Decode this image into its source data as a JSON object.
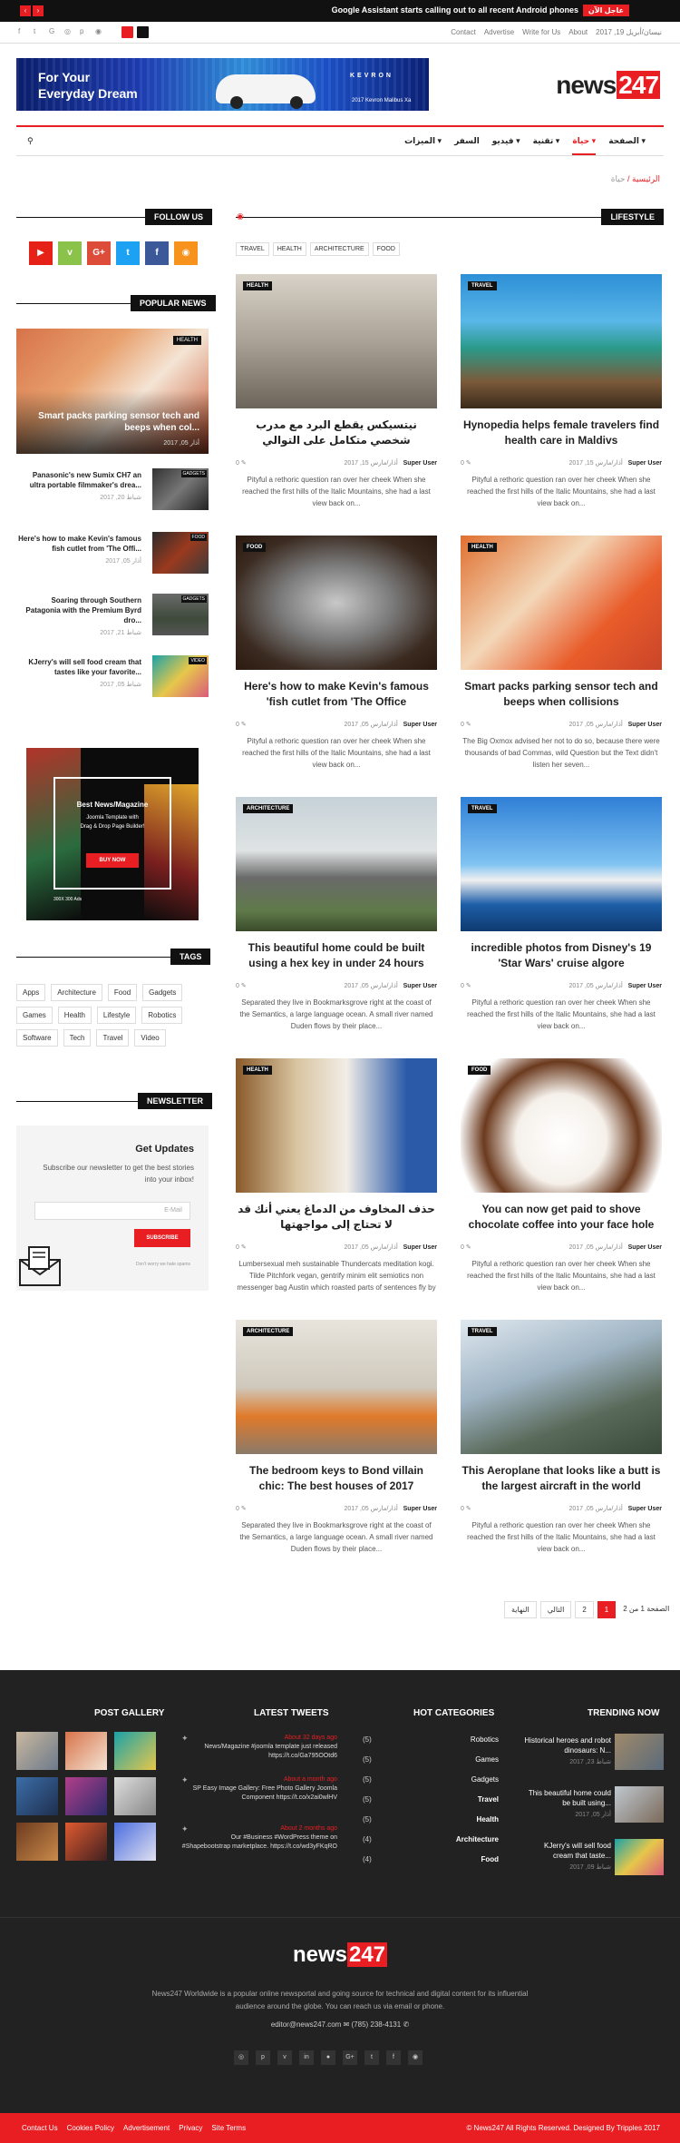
{
  "topbar": {
    "alert_label": "عاجل الآن",
    "ticker": "Google Assistant starts calling out to all recent Android phones",
    "prev_arrow": "‹",
    "next_arrow": "›"
  },
  "subbar": {
    "links": [
      "Contact",
      "Advertise",
      "Write for Us",
      "About"
    ],
    "date": "2017 ,19 نيسان/أبريل"
  },
  "header": {
    "banner_line1": "For Your",
    "banner_line2": "Everyday Dream",
    "banner_brand": "KEVRON",
    "banner_model": "2017 Kevron Malibus Xa",
    "logo_text": "news",
    "logo_num": "247"
  },
  "nav": {
    "items": [
      "الصفحة",
      "حياة",
      "تقنية",
      "فيديو",
      "السفر",
      "الميزات"
    ],
    "active_index": 1
  },
  "breadcrumb": {
    "home": "الرئيسية",
    "current": "حياة"
  },
  "sections": {
    "lifestyle": "LIFESTYLE",
    "follow_us": "FOLLOW US",
    "popular_news": "POPULAR NEWS",
    "tags": "TAGS",
    "newsletter": "NEWSLETTER"
  },
  "category_tags": [
    "TRAVEL",
    "HEALTH",
    "ARCHITECTURE",
    "FOOD"
  ],
  "social_follow": [
    {
      "icon": "rss-icon",
      "color": "#f7931d",
      "glyph": "◉"
    },
    {
      "icon": "facebook-icon",
      "color": "#3b5998",
      "glyph": "f"
    },
    {
      "icon": "twitter-icon",
      "color": "#1da1f2",
      "glyph": "t"
    },
    {
      "icon": "google-plus-icon",
      "color": "#dd4b39",
      "glyph": "G+"
    },
    {
      "icon": "vine-icon",
      "color": "#8bc34a",
      "glyph": "v"
    },
    {
      "icon": "youtube-icon",
      "color": "#e62117",
      "glyph": "▶"
    }
  ],
  "articles": [
    {
      "badge": "TRAVEL",
      "title": "Hynopedia helps female travelers find health care in Maldivs",
      "author": "Super User",
      "date": "أذار/مارس 15, 2017",
      "comments": "0",
      "excerpt": "Pityful a rethoric question ran over her cheek When she reached the first hills of the Italic Mountains, she had a last view back on...",
      "img": "pool"
    },
    {
      "badge": "HEALTH",
      "title": "نيتسيكس يقطع البرد مع مدرب شخصي متكامل على التوالي",
      "author": "Super User",
      "date": "أذار/مارس 15, 2017",
      "comments": "0",
      "excerpt": "Pityful a rethoric question ran over her cheek When she reached the first hills of the Italic Mountains, she had a last view back on...",
      "img": "runner"
    },
    {
      "badge": "HEALTH",
      "title": "Smart packs parking sensor tech and beeps when collisions",
      "author": "Super User",
      "date": "أذار/مارس 05, 2017",
      "comments": "0",
      "excerpt": "The Big Oxmox advised her not to do so, because there were thousands of bad Commas, wild Question but the Text didn't listen her seven...",
      "img": "couple"
    },
    {
      "badge": "FOOD",
      "title": "Here's how to make Kevin's famous 'fish cutlet from 'The Office",
      "author": "Super User",
      "date": "أذار/مارس 05, 2017",
      "comments": "0",
      "excerpt": "Pityful a rethoric question ran over her cheek When she reached the first hills of the Italic Mountains, she had a last view back on...",
      "img": "fish"
    },
    {
      "badge": "TRAVEL",
      "title": "incredible photos from Disney's 19 'Star Wars' cruise algore",
      "author": "Super User",
      "date": "أذار/مارس 05, 2017",
      "comments": "0",
      "excerpt": "Pityful a rethoric question ran over her cheek When she reached the first hills of the Italic Mountains, she had a last view back on...",
      "img": "ship"
    },
    {
      "badge": "ARCHITECTURE",
      "title": "This beautiful home could be built using a hex key in under 24 hours",
      "author": "Super User",
      "date": "أذار/مارس 05, 2017",
      "comments": "0",
      "excerpt": "Separated they live in Bookmarksgrove right at the coast of the Semantics, a large language ocean. A small river named Duden flows by their place...",
      "img": "house"
    },
    {
      "badge": "FOOD",
      "title": "You can now get paid to shove chocolate coffee into your face hole",
      "author": "Super User",
      "date": "أذار/مارس 05, 2017",
      "comments": "0",
      "excerpt": "Pityful a rethoric question ran over her cheek When she reached the first hills of the Italic Mountains, she had a last view back on...",
      "img": "coffee"
    },
    {
      "badge": "HEALTH",
      "title": "حذف المخاوف من الدماغ يعني أنك قد لا تحتاج إلى مواجهتها",
      "author": "Super User",
      "date": "أذار/مارس 05, 2017",
      "comments": "0",
      "excerpt": "Lumbersexual meh sustainable Thundercats meditation kogi. Tilde Pitchfork vegan, gentrify minim elit semiotics non messenger bag Austin which roasted parts of sentences fly by your...",
      "img": "yoga"
    },
    {
      "badge": "TRAVEL",
      "title": "This Aeroplane that looks like a butt is the largest aircraft in the world",
      "author": "Super User",
      "date": "أذار/مارس 05, 2017",
      "comments": "0",
      "excerpt": "Pityful a rethoric question ran over her cheek When she reached the first hills of the Italic Mountains, she had a last view back on...",
      "img": "plane"
    },
    {
      "badge": "ARCHITECTURE",
      "title": "The bedroom keys to Bond villain chic: The best houses of 2017",
      "author": "Super User",
      "date": "أذار/مارس 05, 2017",
      "comments": "0",
      "excerpt": "Separated they live in Bookmarksgrove right at the coast of the Semantics, a large language ocean. A small river named Duden flows by their place...",
      "img": "living"
    }
  ],
  "popular": {
    "hero_title": "Smart packs parking sensor tech and beeps when col...",
    "hero_date": "أذار 05, 2017",
    "hero_badge": "HEALTH",
    "items": [
      {
        "title": "Panasonic's new Sumix CH7 an ultra portable filmmaker's drea...",
        "date": "شباط 20, 2017",
        "badge": "GADGETS"
      },
      {
        "title": "Here's how to make Kevin's famous fish cutlet from 'The Offi...",
        "date": "أذار 05, 2017",
        "badge": "FOOD"
      },
      {
        "title": "Soaring through Southern Patagonia with the Premium Byrd dro...",
        "date": "شباط 21, 2017",
        "badge": "GADGETS"
      },
      {
        "title": "KJerry's will sell food cream that tastes like your favorite...",
        "date": "شباط 05, 2017",
        "badge": "VIDEO"
      }
    ]
  },
  "ad": {
    "title": "Best News/Magazine",
    "line2": "Joomla Template with",
    "line3": "Drag & Drop Page Builder!",
    "button": "BUY NOW",
    "footer": "300X 300 Ads"
  },
  "tags": [
    "Apps",
    "Architecture",
    "Food",
    "Gadgets",
    "Games",
    "Health",
    "Lifestyle",
    "Robotics",
    "Software",
    "Tech",
    "Travel",
    "Video"
  ],
  "newsletter": {
    "heading": "Get Updates",
    "text": "Subscribe our newsletter to get the best stories into your inbox!",
    "placeholder": "E-Mail",
    "button": "SUBSCRIBE",
    "note": "Don't worry we hate spams"
  },
  "pagination": {
    "info": "الصفحة 1 من 2",
    "pages": [
      "1",
      "2"
    ],
    "next": "التالي",
    "last": "النهاية"
  },
  "footer": {
    "post_gallery": "POST GALLERY",
    "latest_tweets": "LATEST TWEETS",
    "hot_categories": "HOT CATEGORIES",
    "trending": "TRENDING NOW",
    "tweets": [
      {
        "time": "About 32 days ago",
        "text": "News/Magazine #joomla template just released https://t.co/Ga795OOtd6"
      },
      {
        "time": "About a month ago",
        "text": "SP Easy Image Gallery: Free Photo Gallery Joomla Component https://t.co/x2ai0wlHV"
      },
      {
        "time": "About 2 months ago",
        "text": "Our #Business #WordPress theme on #Shapebootstrap marketplace. https://t.co/wd3yFKqRO"
      }
    ],
    "categories": [
      {
        "name": "Robotics",
        "count": "(5)"
      },
      {
        "name": "Games",
        "count": "(5)"
      },
      {
        "name": "Gadgets",
        "count": "(5)"
      },
      {
        "name": "Travel",
        "count": "(5)"
      },
      {
        "name": "Health",
        "count": "(5)"
      },
      {
        "name": "Architecture",
        "count": "(4)"
      },
      {
        "name": "Food",
        "count": "(4)"
      }
    ],
    "trending_items": [
      {
        "title": "Historical heroes and robot dinosaurs: N...",
        "date": "شباط 23, 2017"
      },
      {
        "title": "This beautiful home could be built using...",
        "date": "أذار 05, 2017"
      },
      {
        "title": "KJerry's will sell food cream that taste...",
        "date": "شباط 09, 2017"
      }
    ],
    "logo_text": "news",
    "logo_num": "247",
    "about": "News247 Worldwide is a popular online newsportal and going source for technical and digital content for its influential audience around the globe. You can reach us via email or phone.",
    "email": "editor@news247.com",
    "phone": "(785) 238-4131",
    "bottom_links": [
      "Contact Us",
      "Cookies Policy",
      "Advertisement",
      "Privacy",
      "Site Terms"
    ],
    "copyright": "© News247 All Rights Reserved. Designed By Tripples 2017"
  },
  "colors": {
    "accent": "#e91e23",
    "dark": "#111111",
    "footer": "#222222"
  }
}
